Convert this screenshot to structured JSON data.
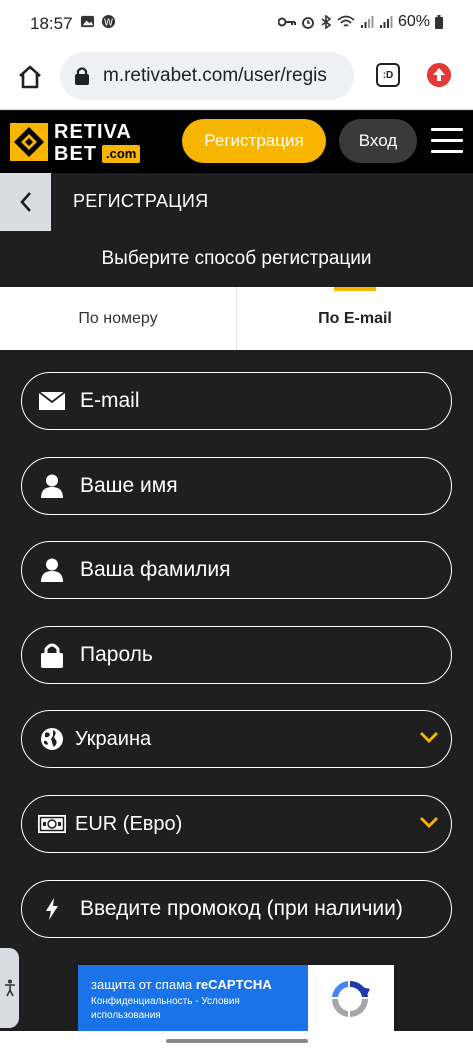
{
  "status_bar": {
    "time": "18:57",
    "battery": "60%"
  },
  "browser": {
    "url": "m.retivabet.com/user/regis",
    "tab_count": ":D"
  },
  "header": {
    "logo_line1": "RETIVA",
    "logo_line2": "BET",
    "logo_com": ".com",
    "register_label": "Регистрация",
    "login_label": "Вход"
  },
  "page": {
    "title": "РЕГИСТРАЦИЯ",
    "subtitle": "Выберите способ регистрации"
  },
  "tabs": [
    {
      "label": "По номеру",
      "active": false
    },
    {
      "label": "По E-mail",
      "active": true
    }
  ],
  "form": {
    "email": "E-mail",
    "first_name": "Ваше имя",
    "last_name": "Ваша фамилия",
    "password": "Пароль",
    "country": "Украина",
    "currency": "EUR (Евро)",
    "promo": "Введите промокод (при наличии)"
  },
  "recaptcha": {
    "title_prefix": "защита от спама ",
    "title_brand": "reCAPTCHA",
    "links": "Конфиденциальность - Условия использования"
  },
  "colors": {
    "accent": "#f7b500",
    "background": "#1f1f1f",
    "header": "#000000",
    "recaptcha_blue": "#1a73e8"
  }
}
